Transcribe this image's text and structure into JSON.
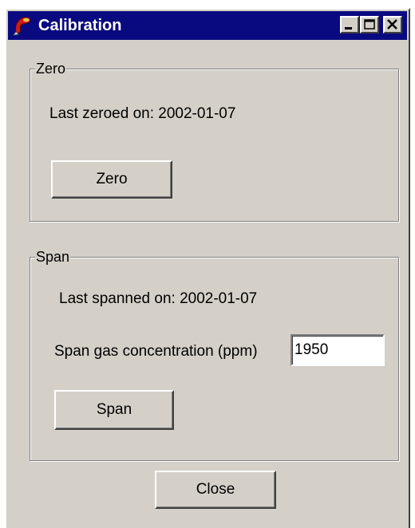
{
  "window": {
    "title": "Calibration",
    "icon": "calibration-app-icon"
  },
  "zero": {
    "legend": "Zero",
    "last_zeroed_text": "Last zeroed on: 2002-01-07",
    "button_label": "Zero"
  },
  "span": {
    "legend": "Span",
    "last_spanned_text": "Last spanned on: 2002-01-07",
    "concentration_label": "Span gas concentration (ppm)",
    "concentration_value": "1950",
    "button_label": "Span"
  },
  "footer": {
    "close_label": "Close"
  },
  "colors": {
    "titlebar": "#0a0a80",
    "face": "#d4d0c8"
  }
}
